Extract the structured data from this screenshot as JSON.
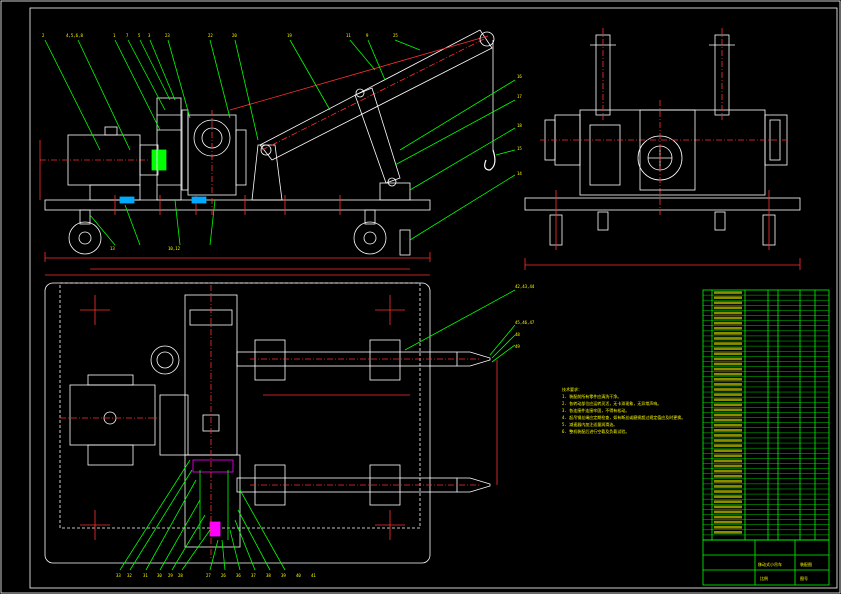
{
  "drawing": {
    "background": "#000000",
    "colors": {
      "frame": "#ffffff",
      "outline": "#ffffff",
      "centerline": "#ff3030",
      "leader": "#00ff00",
      "hidden": "#ff00ff",
      "dimension": "#ff3030",
      "notes": "#ffff00",
      "table": "#00ff00"
    }
  },
  "front_view": {
    "balloons": [
      "2",
      "4,5,6,8",
      "1",
      "7",
      "5",
      "3",
      "23",
      "22",
      "20",
      "19",
      "11",
      "9",
      "25",
      "16",
      "17",
      "18",
      "15",
      "14",
      "13",
      "10,12"
    ]
  },
  "plan_view": {
    "balloons_right": [
      "42,43,44",
      "45,46,47",
      "48",
      "49"
    ],
    "balloons_bottom": [
      "33",
      "32",
      "31",
      "30",
      "29",
      "28",
      "27",
      "26",
      "36",
      "37",
      "38",
      "39",
      "40",
      "41"
    ]
  },
  "tech_notes": {
    "lines": [
      "技术要求：",
      "1. 装配前所有零件应清洗干净。",
      "2. 各转动部位应运转灵活，无卡滞现象，无异常声响。",
      "3. 各连接件连接牢固，不得有松动。",
      "4. 起吊钢丝绳应定期检查，如有断丝或磨损超过规定值应及时更换。",
      "5. 减速器内加注适量润滑油。",
      "6. 整机装配后进行空载及负载试验。"
    ]
  },
  "parts_list": {
    "row_count": 49,
    "title_block": [
      "移动式小吊车",
      "装配图",
      "比例",
      "图号"
    ]
  }
}
